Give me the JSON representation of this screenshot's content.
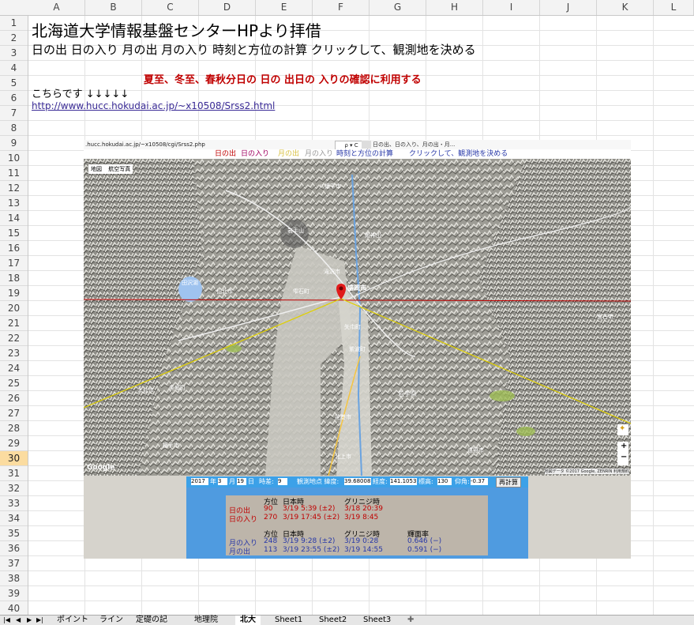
{
  "columns": [
    "A",
    "B",
    "C",
    "D",
    "E",
    "F",
    "G",
    "H",
    "I",
    "J",
    "K",
    "L"
  ],
  "rows": [
    "1",
    "2",
    "3",
    "4",
    "5",
    "6",
    "7",
    "8",
    "9",
    "10",
    "11",
    "12",
    "13",
    "14",
    "15",
    "16",
    "17",
    "18",
    "19",
    "20",
    "21",
    "22",
    "23",
    "24",
    "25",
    "26",
    "27",
    "28",
    "29",
    "30",
    "31",
    "32",
    "33",
    "34",
    "35",
    "36",
    "37",
    "38",
    "39",
    "40"
  ],
  "cells": {
    "title": "北海道大学情報基盤センターHPより拝借",
    "subtitle": "日の出  日の入り  月の出  月の入り  時刻と方位の計算     クリックして、観測地を決める",
    "note": "夏至、冬至、春秋分日の 日の 出日の 入りの確認に利用する",
    "pointer": "こちらです ↓↓↓↓↓",
    "link": "http://www.hucc.hokudai.ac.jp/~x10508/Srss2.html"
  },
  "screenshot": {
    "url": ".hucc.hokudai.ac.jp/~x10508/cgi/Srss2.php",
    "search": "ρ ▾ C",
    "tab": "日の出、日の入り、月の出・月...",
    "nav": {
      "sunrise": "日の出",
      "sunset": "日の入り",
      "moonrise": "月の出",
      "moonset": "月の入り",
      "calc": "時刻と方位の計算",
      "click": "クリックして、観測地を決める"
    },
    "map_buttons": [
      "地図",
      "航空写真"
    ],
    "map_labels": [
      "八幡平市",
      "岩手山",
      "姫神山",
      "盛岡市",
      "滝沢市",
      "雫石町",
      "田沢湖",
      "仙北市",
      "矢巾町",
      "紫波町",
      "花巻市",
      "北上市",
      "岩手県",
      "大仙市",
      "遠野市",
      "宮古市",
      "横手市",
      "美郷町"
    ],
    "map_attr": "地図データ ©2017 Google, ZENRIN  利用規約",
    "google": "Google",
    "form": {
      "year": "2017",
      "year_l": "年",
      "month": "3",
      "month_l": "月",
      "day": "19",
      "day_l": "日",
      "tz_l": "時差:",
      "tz": "9",
      "lat_l": "観測地点 緯度:",
      "lat": "39.68008",
      "lon_l": "経度:",
      "lon": "141.1053",
      "alt_l": "標高:",
      "alt": "130",
      "dip_l": "仰角:",
      "dip": "-0.37",
      "button": "再計算"
    },
    "sun": {
      "h_dir": "方位",
      "h_jst": "日本時",
      "h_gmt": "グリニジ時",
      "rise_l": "日の出",
      "rise_dir": "90",
      "rise_jst": "3/19 5:39 (±2)",
      "rise_gmt": "3/18 20:39",
      "set_l": "日の入り",
      "set_dir": "270",
      "set_jst": "3/19 17:45 (±2)",
      "set_gmt": "3/19 8:45"
    },
    "moon": {
      "h_dir": "方位",
      "h_jst": "日本時",
      "h_gmt": "グリニジ時",
      "h_frac": "輝面率",
      "set_l": "月の入り",
      "set_dir": "248",
      "set_jst": "3/19 9:28 (±2)",
      "set_gmt": "3/19 0:28",
      "set_frac": "0.646 (−)",
      "rise_l": "月の出",
      "rise_dir": "113",
      "rise_jst": "3/19 23:55 (±2)",
      "rise_gmt": "3/19 14:55",
      "rise_frac": "0.591 (−)"
    }
  },
  "sheet_tabs": [
    "ポイント",
    "ライン",
    "定礎の記",
    "地理院",
    "北大",
    "Sheet1",
    "Sheet2",
    "Sheet3"
  ],
  "active_tab": "北大",
  "colors": {
    "red_text": "#c00000",
    "link": "#3b2c97",
    "selected_row": "#fbdca0",
    "panel_blue": "#4f9be0"
  }
}
